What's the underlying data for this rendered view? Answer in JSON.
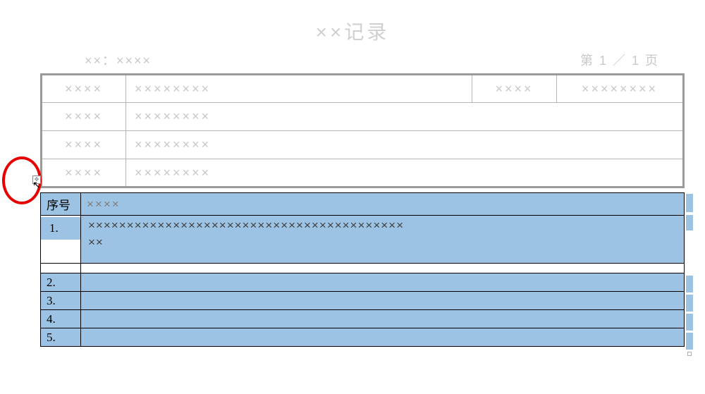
{
  "title": "××记录",
  "subheader": {
    "left": "××：××××",
    "right": "第 1 ／ 1 页"
  },
  "table1": {
    "rows": [
      {
        "c1": "××××",
        "c2": "××××××××",
        "c3": "××××",
        "c4": "××××××××"
      },
      {
        "c1": "××××",
        "c2": "××××××××"
      },
      {
        "c1": "××××",
        "c2": "××××××××"
      },
      {
        "c1": "××××",
        "c2": "××××××××"
      }
    ]
  },
  "table2": {
    "header": {
      "c1": "序号",
      "c2": "××××"
    },
    "row1": {
      "c1": "1.",
      "c2_line1": "×××××××××××××××××××××××××××××××××××××××××",
      "c2_line2": "××"
    },
    "rows_rest": [
      "2.",
      "3.",
      "4.",
      "5."
    ]
  },
  "colors": {
    "highlight": "#9cc3e4",
    "annotation": "#e60000"
  }
}
